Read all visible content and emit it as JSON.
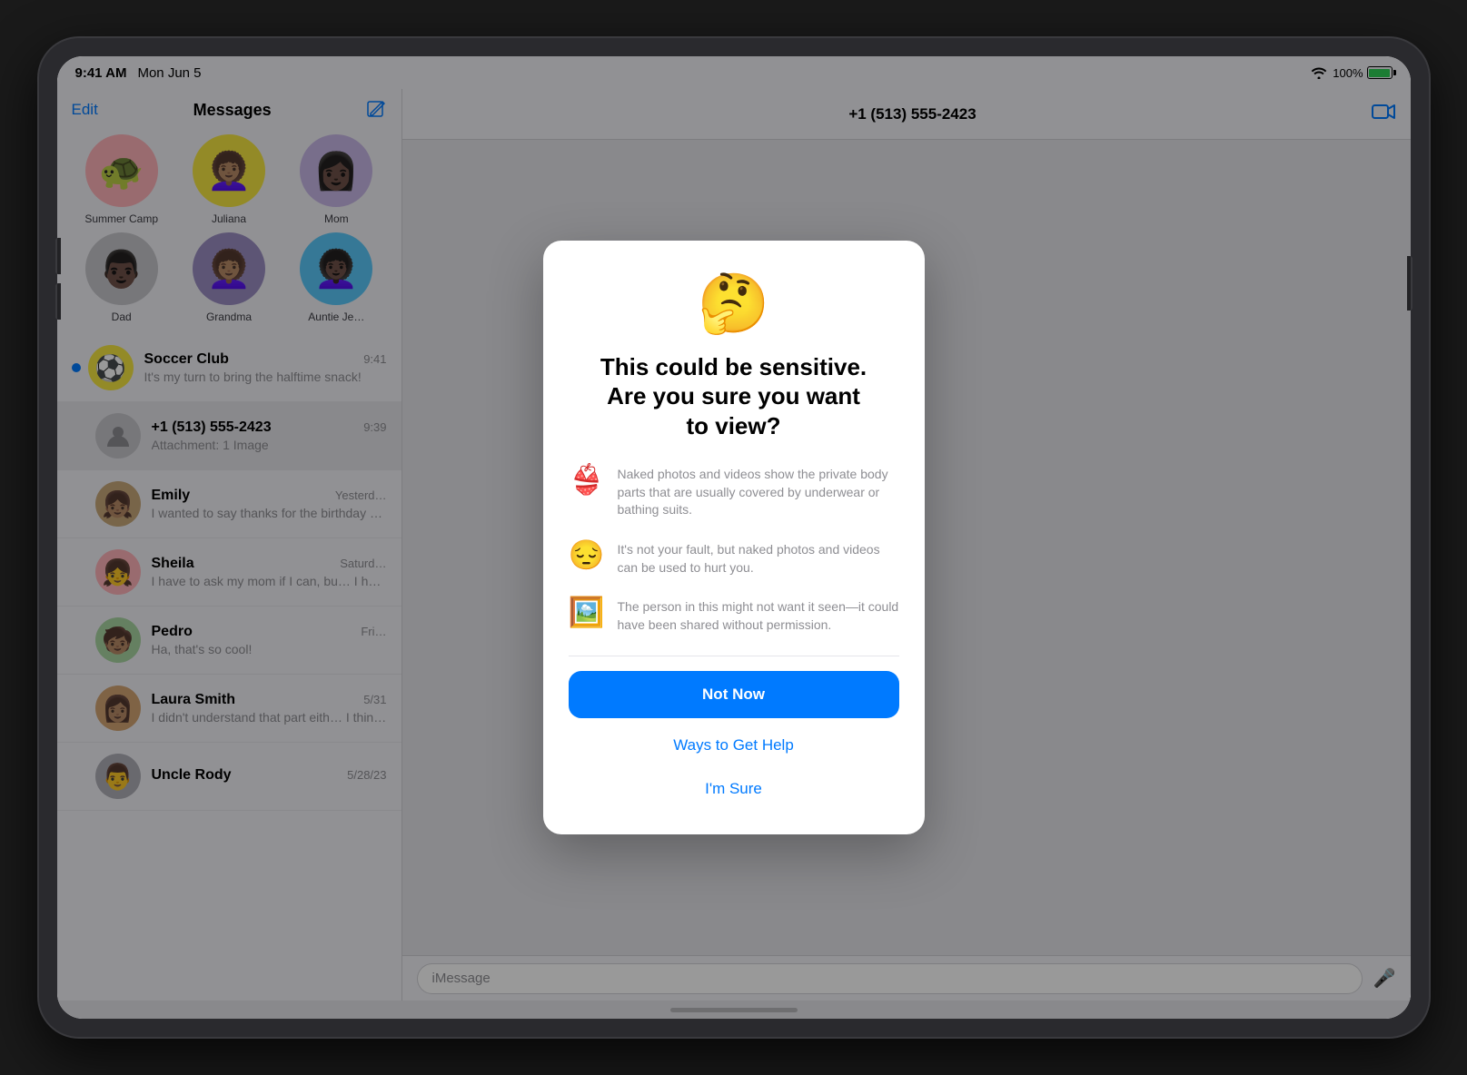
{
  "status_bar": {
    "time": "9:41 AM",
    "date": "Mon Jun 5",
    "battery_percent": "100%"
  },
  "sidebar": {
    "edit_label": "Edit",
    "title": "Messages",
    "pinned_contacts": [
      {
        "name": "Summer Camp",
        "emoji": "🐢",
        "bg": "pink"
      },
      {
        "name": "Juliana",
        "emoji": "🧑‍🦱",
        "bg": "yellow"
      },
      {
        "name": "Mom",
        "emoji": "👩🏿",
        "bg": "lavender"
      },
      {
        "name": "Dad",
        "emoji": "👨🏿",
        "bg": "gray"
      },
      {
        "name": "Grandma",
        "emoji": "👩🏽‍🦱",
        "bg": "purple"
      },
      {
        "name": "Auntie Je…",
        "emoji": "👩🏿‍🦱",
        "bg": "teal"
      }
    ],
    "messages": [
      {
        "id": "soccer-club",
        "sender": "Soccer Club",
        "time": "9:41",
        "preview": "It's my turn to bring the halftime snack!",
        "unread": true,
        "emoji": "⚽"
      },
      {
        "id": "unknown",
        "sender": "+1 (513) 555-2423",
        "time": "9:39",
        "preview": "Attachment: 1 Image",
        "unread": false,
        "emoji": "👤",
        "selected": true
      },
      {
        "id": "emily",
        "sender": "Emily",
        "time": "Yesterd…",
        "preview": "I wanted to say thanks for the birthday present! I play with it every day in the yard!",
        "unread": false,
        "emoji": "👧🏽"
      },
      {
        "id": "sheila",
        "sender": "Sheila",
        "time": "Saturd…",
        "preview": "I have to ask my mom if I can, bu… I hope so!",
        "unread": false,
        "emoji": "👧"
      },
      {
        "id": "pedro",
        "sender": "Pedro",
        "time": "Fri…",
        "preview": "Ha, that's so cool!",
        "unread": false,
        "emoji": "🧒🏽"
      },
      {
        "id": "laura-smith",
        "sender": "Laura Smith",
        "time": "5/31",
        "preview": "I didn't understand that part eith… I think the quiz is on Thursday now.",
        "unread": false,
        "emoji": "👩🏽"
      },
      {
        "id": "uncle-rody",
        "sender": "Uncle Rody",
        "time": "5/28/23",
        "preview": "",
        "unread": false,
        "emoji": "👨"
      }
    ]
  },
  "chat": {
    "contact": "+1 (513) 555-2423",
    "input_placeholder": "iMessage"
  },
  "dialog": {
    "emoji": "🤔",
    "title": "This could be sensitive.\nAre you sure you want\nto view?",
    "items": [
      {
        "icon": "👙",
        "text": "Naked photos and videos show the private body parts that are usually covered by underwear or bathing suits."
      },
      {
        "icon": "😔",
        "text": "It's not your fault, but naked photos and videos can be used to hurt you."
      },
      {
        "icon": "🖼️",
        "text": "The person in this might not want it seen—it could have been shared without permission."
      }
    ],
    "not_now_label": "Not Now",
    "ways_label": "Ways to Get Help",
    "sure_label": "I'm Sure"
  }
}
